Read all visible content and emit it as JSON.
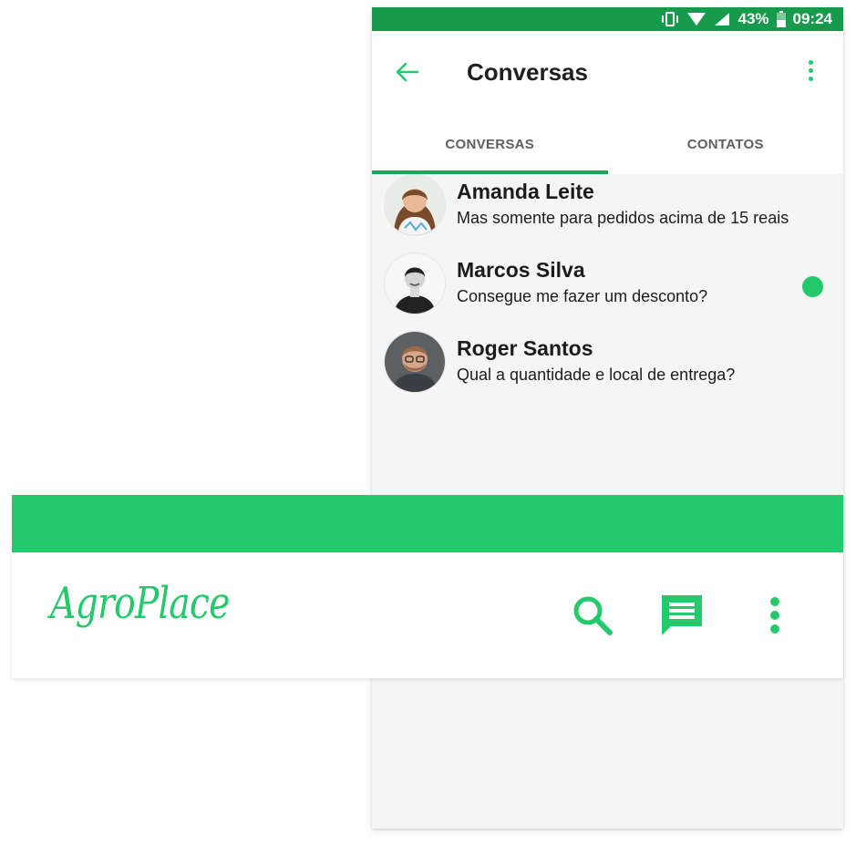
{
  "status_bar": {
    "battery": "43%",
    "time": "09:24"
  },
  "toolbar": {
    "back_icon": "arrow-left-icon",
    "title": "Conversas",
    "menu_icon": "more-vert-icon"
  },
  "tabs": [
    {
      "label": "CONVERSAS",
      "active": true
    },
    {
      "label": "CONTATOS",
      "active": false
    }
  ],
  "conversations": [
    {
      "name": "Amanda Leite",
      "message": "Mas somente para pedidos acima de 15 reais",
      "unread": false
    },
    {
      "name": "Marcos Silva",
      "message": "Consegue me fazer um desconto?",
      "unread": true
    },
    {
      "name": "Roger Santos",
      "message": "Qual a quantidade e local de entrega?",
      "unread": false
    }
  ],
  "overlay": {
    "logo": "AgroPlace",
    "icons": [
      "search-icon",
      "message-icon",
      "more-vert-icon"
    ]
  },
  "colors": {
    "accent": "#23c96a",
    "status_bar": "#189a4c",
    "tab_indicator": "#1ea55a"
  }
}
